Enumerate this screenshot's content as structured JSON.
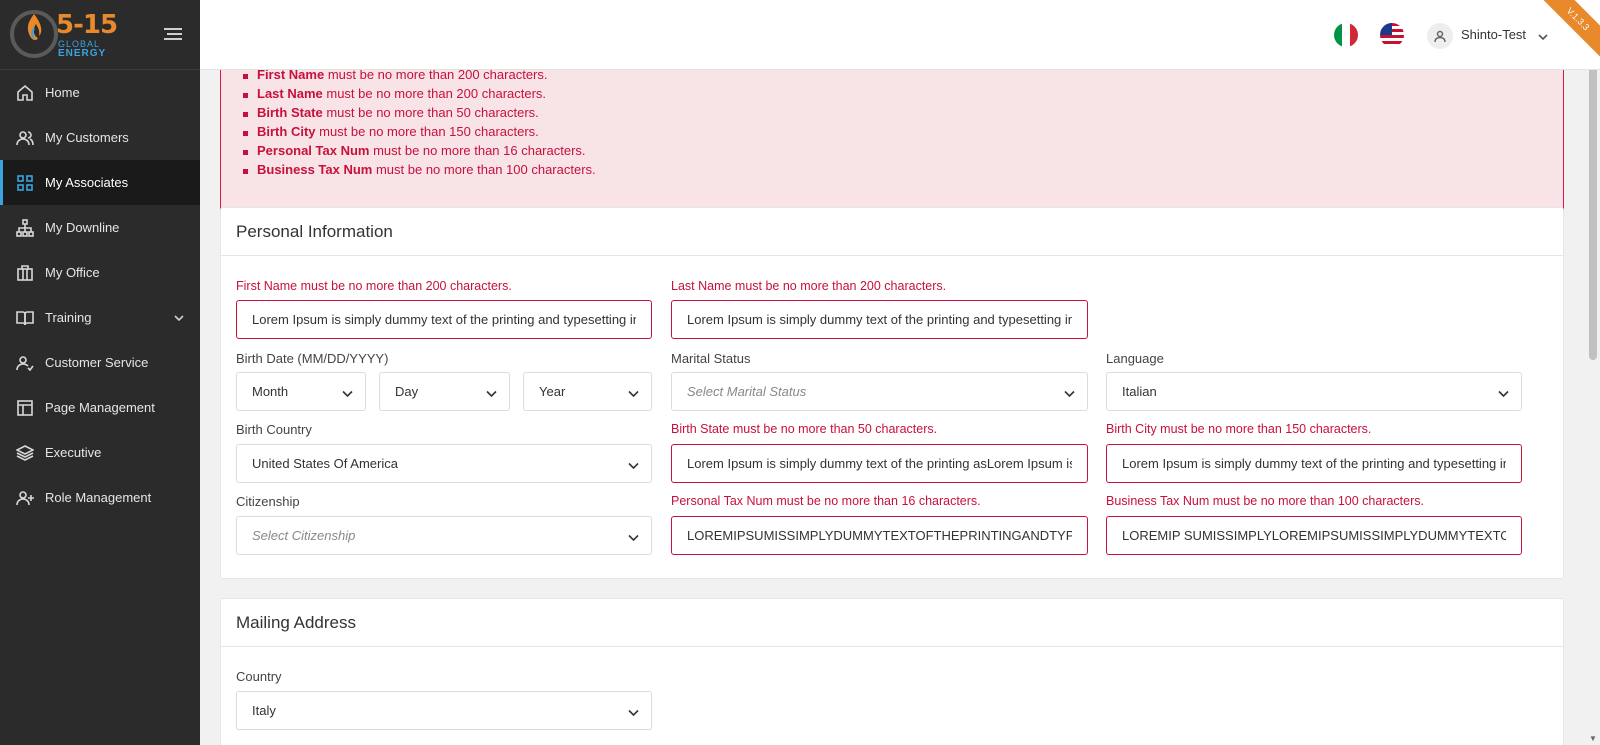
{
  "brand": {
    "logo_number": "5-15",
    "logo_line1": "GLOBAL",
    "logo_line2": "ENERGY",
    "accent": "#e8892b",
    "secondary": "#3aa3e0",
    "version": "V.1.3.3"
  },
  "sidebar": {
    "items": [
      {
        "label": "Home",
        "icon": "home-icon"
      },
      {
        "label": "My Customers",
        "icon": "users-icon"
      },
      {
        "label": "My Associates",
        "icon": "grid-icon",
        "active": true
      },
      {
        "label": "My Downline",
        "icon": "hierarchy-icon"
      },
      {
        "label": "My Office",
        "icon": "briefcase-icon"
      },
      {
        "label": "Training",
        "icon": "book-icon",
        "has_submenu": true
      },
      {
        "label": "Customer Service",
        "icon": "user-check-icon"
      },
      {
        "label": "Page Management",
        "icon": "layout-icon"
      },
      {
        "label": "Executive",
        "icon": "layers-icon"
      },
      {
        "label": "Role Management",
        "icon": "user-plus-icon"
      }
    ]
  },
  "header": {
    "user_name": "Shinto-Test",
    "flags": [
      "italy-flag-icon",
      "usa-flag-icon"
    ]
  },
  "errors": {
    "items": [
      {
        "field": "First Name",
        "msg": " must be no more than 200 characters."
      },
      {
        "field": "Last Name",
        "msg": " must be no more than 200 characters."
      },
      {
        "field": "Birth State",
        "msg": " must be no more than 50 characters."
      },
      {
        "field": "Birth City",
        "msg": " must be no more than 150 characters."
      },
      {
        "field": "Personal Tax Num",
        "msg": " must be no more than 16 characters."
      },
      {
        "field": "Business Tax Num",
        "msg": " must be no more than 100 characters."
      }
    ]
  },
  "personal": {
    "title": "Personal Information",
    "first_name_error": "First Name must be no more than 200 characters.",
    "first_name_value": "Lorem Ipsum is simply dummy text of the printing and typesetting industry",
    "last_name_error": "Last Name must be no more than 200 characters.",
    "last_name_value": "Lorem Ipsum is simply dummy text of the printing and typesetting industry",
    "birth_date_label": "Birth Date (MM/DD/YYYY)",
    "month": "Month",
    "day": "Day",
    "year": "Year",
    "marital_label": "Marital Status",
    "marital_placeholder": "Select Marital Status",
    "language_label": "Language",
    "language_value": "Italian",
    "birth_country_label": "Birth Country",
    "birth_country_value": "United States Of America",
    "birth_state_error": "Birth State must be no more than 50 characters.",
    "birth_state_value": "Lorem Ipsum is simply dummy text of the printing asLorem Ipsum is simply",
    "birth_city_error": "Birth City must be no more than 150 characters.",
    "birth_city_value": "Lorem Ipsum is simply dummy text of the printing and typesetting industry",
    "citizenship_label": "Citizenship",
    "citizenship_placeholder": "Select Citizenship",
    "personal_tax_error": "Personal Tax Num must be no more than 16 characters.",
    "personal_tax_value": "LOREMIPSUMISSIMPLYDUMMYTEXTOFTHEPRINTINGANDTYPESETTING",
    "business_tax_error": "Business Tax Num must be no more than 100 characters.",
    "business_tax_value": "LOREMIP SUMISSIMPLYLOREMIPSUMISSIMPLYDUMMYTEXTOFTHEPRINTING"
  },
  "mailing": {
    "title": "Mailing Address",
    "country_label": "Country",
    "country_value": "Italy"
  }
}
